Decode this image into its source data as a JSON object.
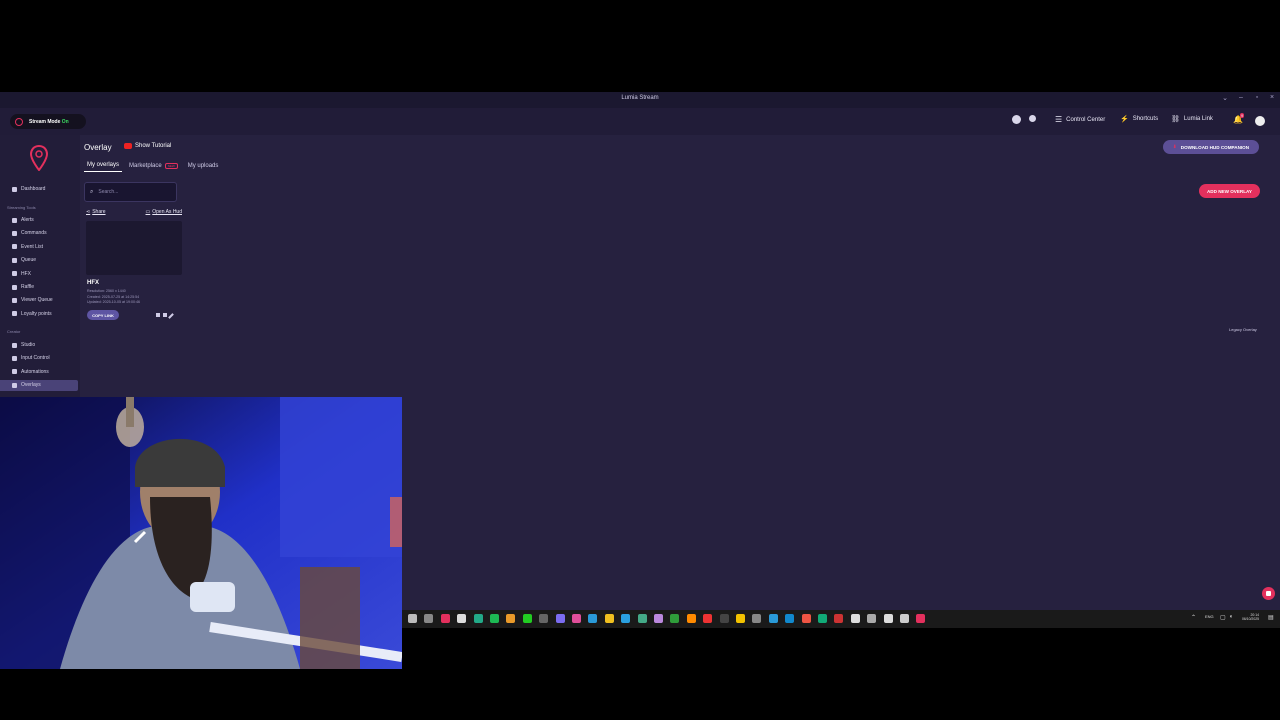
{
  "window": {
    "title": "Lumia Stream"
  },
  "topbar": {
    "stream_mode_label": "Stream Mode",
    "stream_mode_state": "On",
    "control_center": "Control Center",
    "shortcuts": "Shortcuts",
    "lumia_link": "Lumia Link",
    "notification_count": "9"
  },
  "sidebar": {
    "dashboard": "Dashboard",
    "section_streaming": "Streaming Tools",
    "streaming_items": [
      "Alerts",
      "Commands",
      "Event List",
      "Queue",
      "HFX",
      "Raffle",
      "Viewer Queue",
      "Loyalty points"
    ],
    "section_creator": "Creator",
    "creator_items": [
      "Studio",
      "Input Control",
      "Automations",
      "Overlays"
    ]
  },
  "page": {
    "title": "Overlay",
    "show_tutorial": "Show Tutorial",
    "tabs": [
      "My overlays",
      "Marketplace",
      "My uploads"
    ],
    "new_badge": "NEW",
    "search_placeholder": "Search...",
    "download_hud": "DOWNLOAD HUD COMPANION",
    "add_new_overlay": "ADD NEW OVERLAY",
    "legacy_overlay": "Legacy Overlay"
  },
  "overlay_card": {
    "share": "Share",
    "open_as_hud": "Open As Hud",
    "name": "HFX",
    "resolution": "Resolution: 2560 x 1440",
    "created": "Created: 2025-07-25 at 14:25:54",
    "updated": "Updated: 2025-10-05 at 19:00:46",
    "copy_link": "COPY LINK"
  },
  "tray": {
    "lang": "ENG",
    "time": "20:14",
    "date": "06/10/2025"
  },
  "colors": {
    "accent": "#e3305d",
    "background": "#26213f",
    "sidebar": "#221d39",
    "active_item": "#4a4378",
    "stream_on": "#3ddc63"
  }
}
